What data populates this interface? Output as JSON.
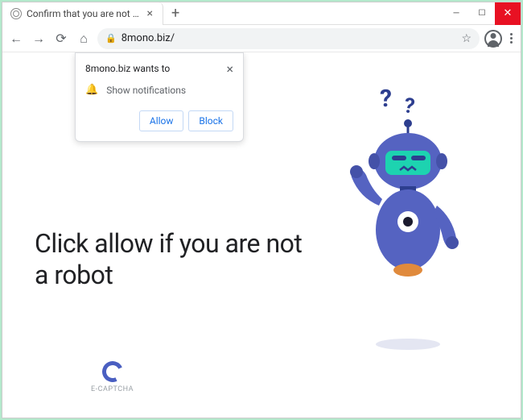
{
  "window": {
    "tab_title": "Confirm that you are not a robot",
    "new_tab": "+"
  },
  "toolbar": {
    "url": "8mono.biz/"
  },
  "popup": {
    "site_wants_to": "8mono.biz wants to",
    "permission_label": "Show notifications",
    "allow_label": "Allow",
    "block_label": "Block"
  },
  "page": {
    "headline": "Click allow if you are not a robot",
    "captcha_label": "E-CAPTCHA"
  }
}
